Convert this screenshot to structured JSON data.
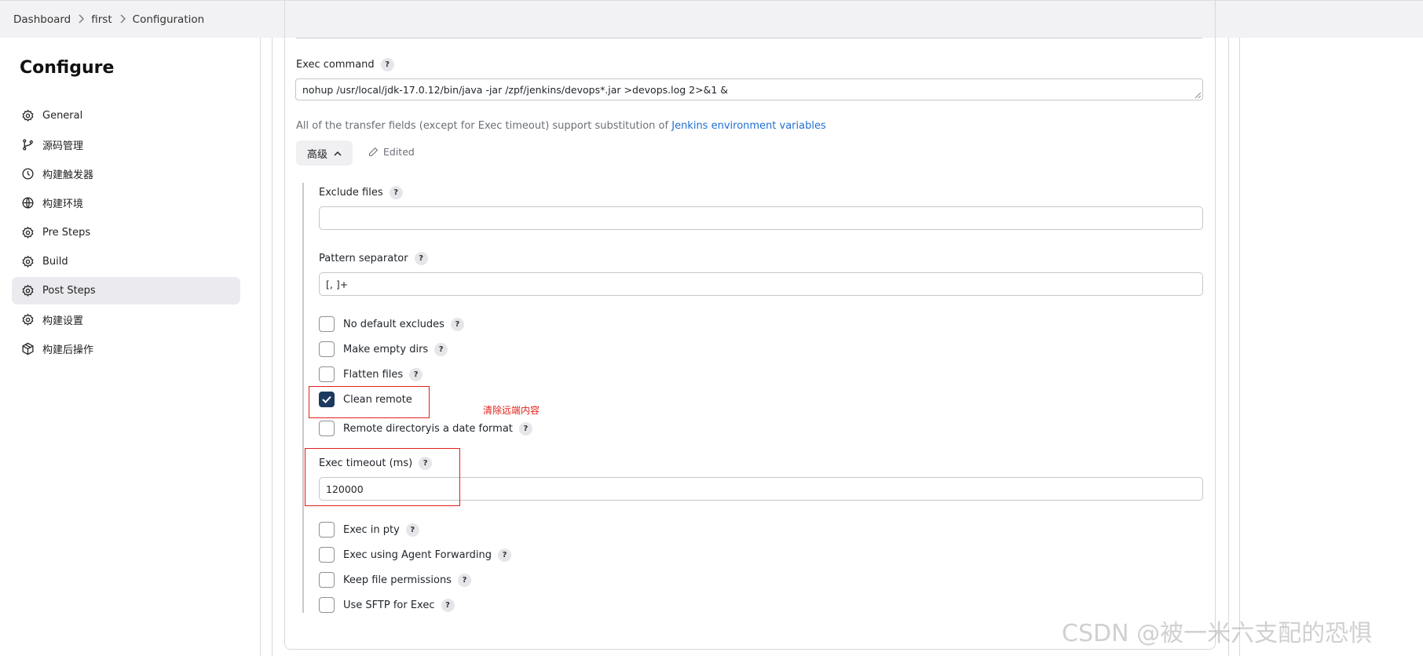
{
  "breadcrumb": [
    "Dashboard",
    "first",
    "Configuration"
  ],
  "sidebar": {
    "title": "Configure",
    "items": [
      {
        "label": "General",
        "icon": "gear-icon"
      },
      {
        "label": "源码管理",
        "icon": "branch-icon"
      },
      {
        "label": "构建触发器",
        "icon": "clock-icon"
      },
      {
        "label": "构建环境",
        "icon": "globe-icon"
      },
      {
        "label": "Pre Steps",
        "icon": "gear-icon"
      },
      {
        "label": "Build",
        "icon": "gear-icon"
      },
      {
        "label": "Post Steps",
        "icon": "gear-icon",
        "active": true
      },
      {
        "label": "构建设置",
        "icon": "gear-icon"
      },
      {
        "label": "构建后操作",
        "icon": "package-icon"
      }
    ]
  },
  "main": {
    "exec_command": {
      "label": "Exec command",
      "value": "nohup /usr/local/jdk-17.0.12/bin/java -jar /zpf/jenkins/devops*.jar  >devops.log  2>&1 &"
    },
    "hint_text": "All of the transfer fields (except for Exec timeout) support substitution of ",
    "hint_link": "Jenkins environment variables",
    "advanced_label": "高级",
    "edited_label": "Edited",
    "exclude_files": {
      "label": "Exclude files",
      "value": ""
    },
    "pattern_separator": {
      "label": "Pattern separator",
      "value": "[, ]+"
    },
    "checkboxes_top": [
      {
        "label": "No default excludes",
        "checked": false,
        "help": true
      },
      {
        "label": "Make empty dirs",
        "checked": false,
        "help": true
      },
      {
        "label": "Flatten files",
        "checked": false,
        "help": true
      },
      {
        "label": "Clean remote",
        "checked": true,
        "help": false
      },
      {
        "label": "Remote directoryis a date format",
        "checked": false,
        "help": true
      }
    ],
    "annotation_note": "清除远端内容",
    "exec_timeout": {
      "label": "Exec timeout (ms)",
      "value": "120000"
    },
    "checkboxes_bottom": [
      {
        "label": "Exec in pty",
        "checked": false,
        "help": true
      },
      {
        "label": "Exec using Agent Forwarding",
        "checked": false,
        "help": true
      },
      {
        "label": "Keep file permissions",
        "checked": false,
        "help": true
      },
      {
        "label": "Use SFTP for Exec",
        "checked": false,
        "help": true
      }
    ],
    "help_symbol": "?"
  },
  "watermark": "CSDN @被一米六支配的恐惧"
}
